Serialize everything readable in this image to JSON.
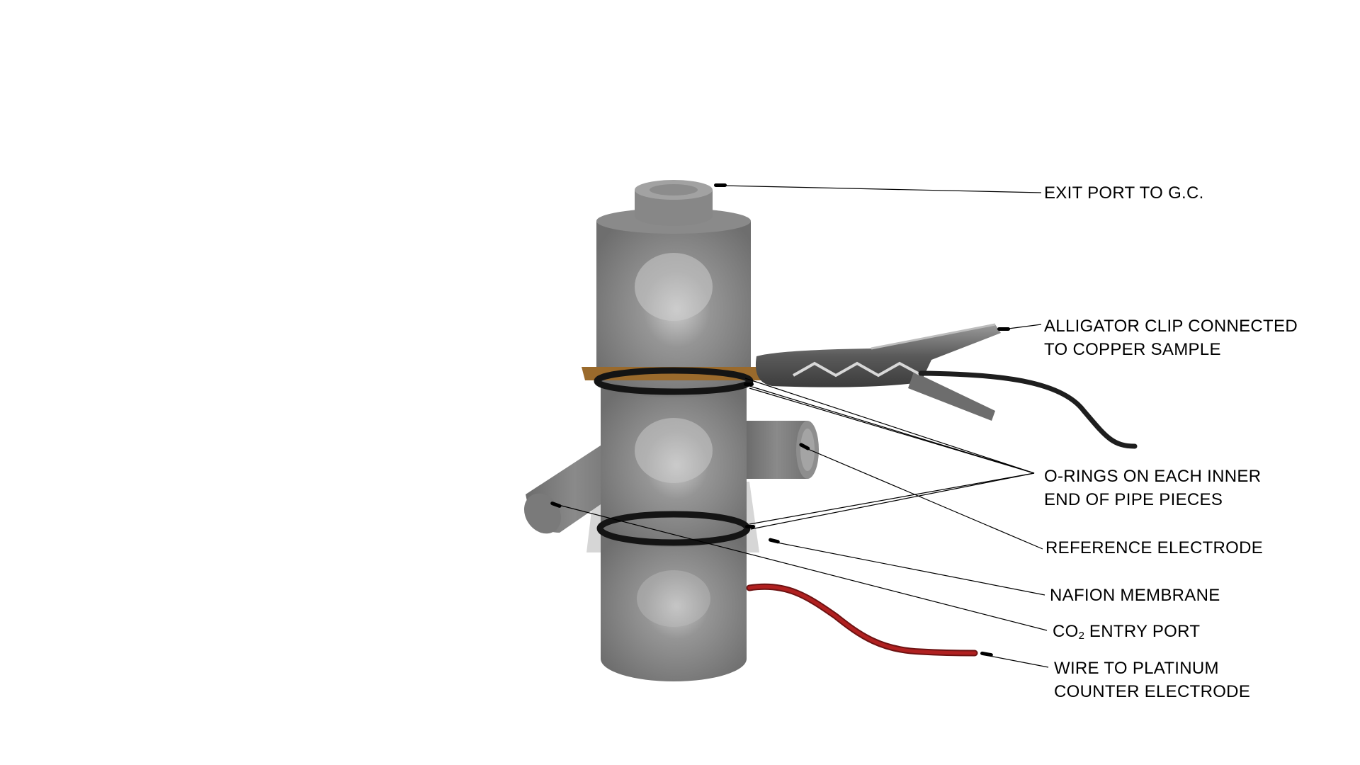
{
  "labels": {
    "exit_port": "EXIT PORT TO G.C.",
    "alligator_clip_line1": "ALLIGATOR CLIP CONNECTED",
    "alligator_clip_line2": "TO COPPER SAMPLE",
    "o_rings_line1": "O-RINGS ON EACH INNER",
    "o_rings_line2": "END OF PIPE PIECES",
    "reference_electrode": "REFERENCE ELECTRODE",
    "nafion_membrane": "NAFION MEMBRANE",
    "co2_prefix": "CO",
    "co2_subscript": "2",
    "co2_suffix": " ENTRY PORT",
    "wire_line1": "WIRE TO PLATINUM",
    "wire_line2": "COUNTER ELECTRODE"
  },
  "colors": {
    "pipe_body": "#7f7f7f",
    "pipe_highlight": "#c4c4c4",
    "o_ring": "#141414",
    "copper_sample": "#9a6a2c",
    "membrane": "#d4d4d4",
    "red_wire": "#a01c1c",
    "black_wire": "#1e1e1e",
    "leader_line": "#000000"
  }
}
